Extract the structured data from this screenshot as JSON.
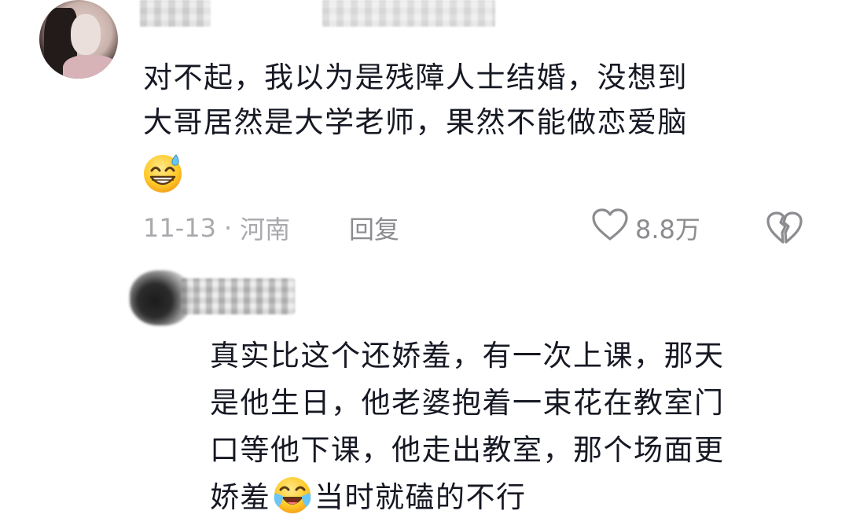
{
  "comment": {
    "text_lines": [
      "对不起，我以为是残障人士结婚，没想到",
      "大哥居然是大学老师，果然不能做恋爱脑"
    ],
    "emoji_icon": "grinning-sweat-emoji",
    "date": "11-13",
    "separator": "·",
    "location": "河南",
    "reply_label": "回复",
    "like_count": "8.8万",
    "like_icon": "heart-outline-icon",
    "dislike_icon": "broken-heart-icon"
  },
  "reply": {
    "text_lines": [
      "真实比这个还娇羞，有一次上课，那天",
      "是他生日，他老婆抱着一束花在教室门",
      "口等他下课，他走出教室，那个场面更"
    ],
    "last_line_before_emoji": "娇羞",
    "inline_emoji_icon": "crying-laughing-emoji",
    "last_line_after_emoji": "当时就磕的不行"
  },
  "colors": {
    "text": "#161823",
    "meta": "#a9a9ae",
    "icon": "#8c8c90"
  }
}
